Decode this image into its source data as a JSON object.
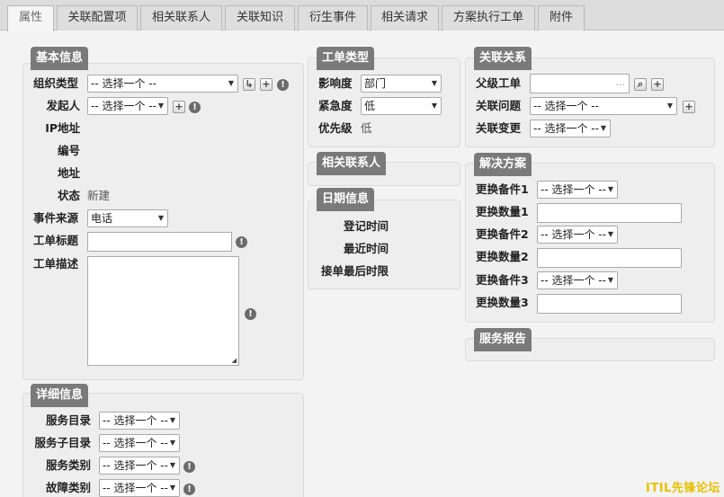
{
  "tabs": [
    "属性",
    "关联配置项",
    "相关联系人",
    "关联知识",
    "衍生事件",
    "相关请求",
    "方案执行工单",
    "附件"
  ],
  "basic": {
    "title": "基本信息",
    "org_type_label": "组织类型",
    "org_type_value": "-- 选择一个 --",
    "initiator_label": "发起人",
    "initiator_value": "-- 选择一个 --",
    "ip_label": "IP地址",
    "code_label": "编号",
    "address_label": "地址",
    "status_label": "状态",
    "status_value": "新建",
    "source_label": "事件来源",
    "source_value": "电话",
    "title_label": "工单标题",
    "desc_label": "工单描述"
  },
  "detail": {
    "title": "详细信息",
    "service_catalog_label": "服务目录",
    "service_catalog_value": "-- 选择一个 --",
    "service_sub_label": "服务子目录",
    "service_sub_value": "-- 选择一个 --",
    "service_type_label": "服务类别",
    "service_type_value": "-- 选择一个 --",
    "fault_type_label": "故障类别",
    "fault_type_value": "-- 选择一个 --"
  },
  "ticket_type": {
    "title": "工单类型",
    "impact_label": "影响度",
    "impact_value": "部门",
    "urgency_label": "紧急度",
    "urgency_value": "低",
    "priority_label": "优先级",
    "priority_value": "低"
  },
  "contacts": {
    "title": "相关联系人"
  },
  "dates": {
    "title": "日期信息",
    "register_label": "登记时间",
    "recent_label": "最近时间",
    "deadline_label": "接单最后时限"
  },
  "relations": {
    "title": "关联关系",
    "parent_label": "父级工单",
    "parent_placeholder": "...",
    "problem_label": "关联问题",
    "problem_value": "-- 选择一个 --",
    "change_label": "关联变更",
    "change_value": "-- 选择一个 --"
  },
  "solution": {
    "title": "解决方案",
    "part1_label": "更换备件1",
    "part1_value": "-- 选择一个 --",
    "qty1_label": "更换数量1",
    "part2_label": "更换备件2",
    "part2_value": "-- 选择一个 --",
    "qty2_label": "更换数量2",
    "part3_label": "更换备件3",
    "part3_value": "-- 选择一个 --",
    "qty3_label": "更换数量3"
  },
  "report": {
    "title": "服务报告"
  },
  "watermark": "ITIL先锋论坛",
  "colors": {
    "panel_title_bg": "#7a7a7a",
    "panel_bg": "#eeeeee",
    "tab_bg": "#dedede",
    "watermark": "#e7c000"
  }
}
